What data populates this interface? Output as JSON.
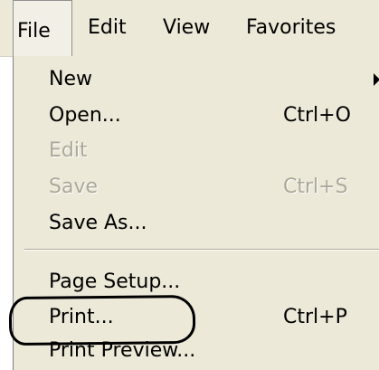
{
  "menubar": {
    "items": [
      {
        "label": "File"
      },
      {
        "label": "Edit"
      },
      {
        "label": "View"
      },
      {
        "label": "Favorites"
      }
    ]
  },
  "file_menu": {
    "items": [
      {
        "label": "New",
        "shortcut": "",
        "enabled": true,
        "submenu": true
      },
      {
        "label": "Open...",
        "shortcut": "Ctrl+O",
        "enabled": true
      },
      {
        "label": "Edit",
        "shortcut": "",
        "enabled": false
      },
      {
        "label": "Save",
        "shortcut": "Ctrl+S",
        "enabled": false
      },
      {
        "label": "Save As...",
        "shortcut": "",
        "enabled": true
      },
      {
        "label": "Page Setup...",
        "shortcut": "",
        "enabled": true
      },
      {
        "label": "Print...",
        "shortcut": "Ctrl+P",
        "enabled": true,
        "highlighted_by_annotation": true
      },
      {
        "label": "Print Preview...",
        "shortcut": "",
        "enabled": true
      }
    ]
  },
  "colors": {
    "menu_background": "#ece9d8",
    "disabled_text": "#aca899",
    "annotation": "#000000"
  }
}
